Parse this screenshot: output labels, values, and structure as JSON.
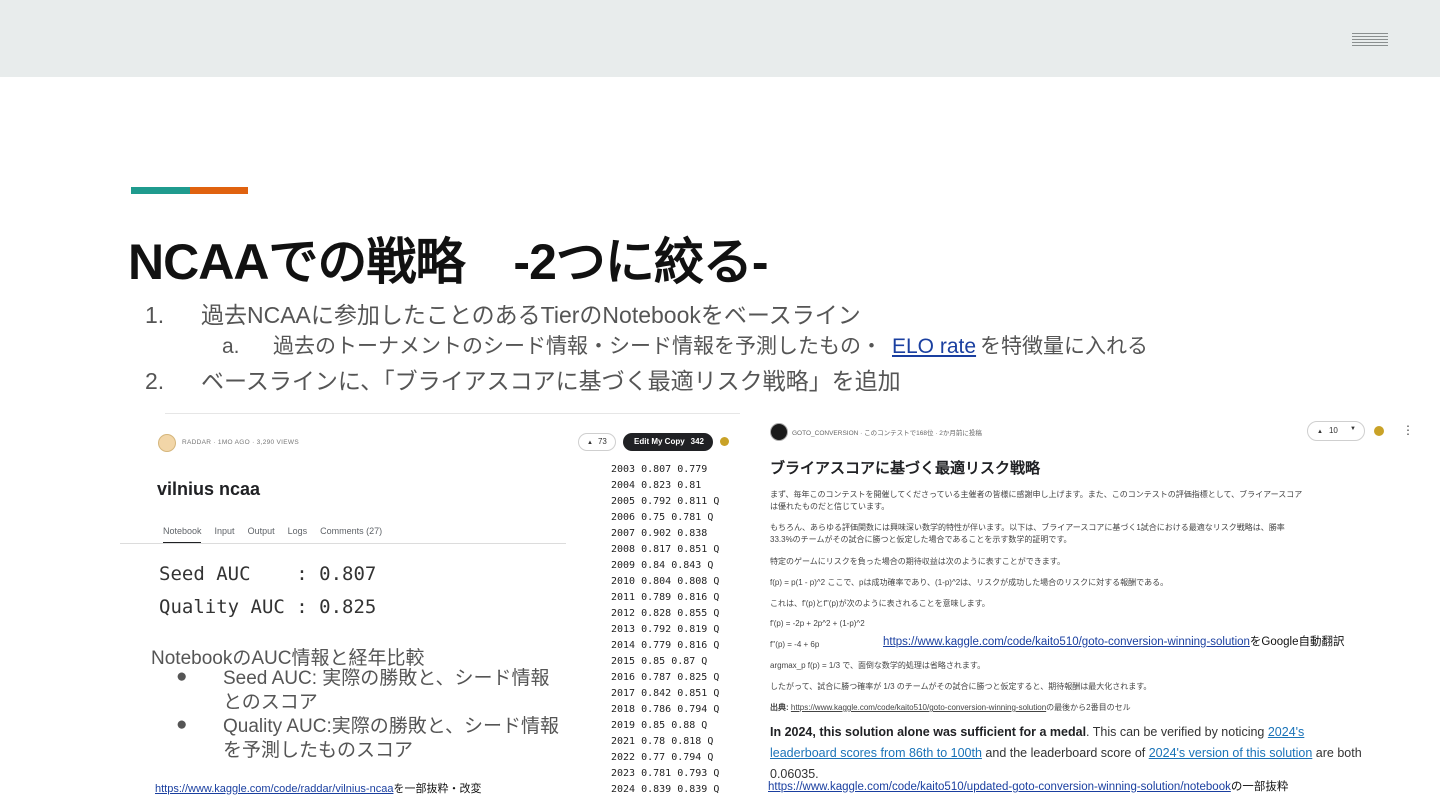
{
  "slide": {
    "title": "NCAAでの戦略　-2つに絞る-",
    "outline": [
      {
        "num": "1.",
        "text": "過去NCAAに参加したことのあるTierのNotebookをベースライン"
      },
      {
        "num": "2.",
        "text": "ベースラインに、「ブライアスコアに基づく最適リスク戦略」を追加"
      }
    ],
    "sub": {
      "num": "a.",
      "before": "過去のトーナメントのシード情報・シード情報を予測したもの・",
      "link": "ELO rate",
      "after": "を特徴量に入れる"
    }
  },
  "left_shot": {
    "author": "RADDAR · 1MO AGO · 3,290 VIEWS",
    "votes": "73",
    "edit_label": "Edit My Copy",
    "edit_count": "342",
    "notebook_title": "vilnius ncaa",
    "tabs": [
      "Notebook",
      "Input",
      "Output",
      "Logs",
      "Comments (27)"
    ],
    "seed_auc": "Seed AUC    : 0.807",
    "quality_auc": "Quality AUC : 0.825",
    "years": [
      "2003 0.807 0.779",
      "2004 0.823 0.81",
      "2005 0.792 0.811 Q",
      "2006 0.75 0.781 Q",
      "2007 0.902 0.838",
      "2008 0.817 0.851 Q",
      "2009 0.84 0.843 Q",
      "2010 0.804 0.808 Q",
      "2011 0.789 0.816 Q",
      "2012 0.828 0.855 Q",
      "2013 0.792 0.819 Q",
      "2014 0.779 0.816 Q",
      "2015 0.85 0.87 Q",
      "2016 0.787 0.825 Q",
      "2017 0.842 0.851 Q",
      "2018 0.786 0.794 Q",
      "2019 0.85 0.88 Q",
      "2021 0.78 0.818 Q",
      "2022 0.77 0.794 Q",
      "2023 0.781 0.793 Q",
      "2024 0.839 0.839 Q"
    ]
  },
  "left_notes": {
    "heading": "NotebookのAUC情報と経年比較",
    "bullets": [
      "Seed AUC: 実際の勝敗と、シード情報とのスコア",
      "Quality AUC:実際の勝敗と、シード情報を予測したものスコア"
    ],
    "bullet_char": "●",
    "source_link": "https://www.kaggle.com/code/raddar/vilnius-ncaa",
    "source_suffix": "を一部抜粋・改変"
  },
  "right_shot": {
    "author": "GOTO_CONVERSION · このコンテストで168位 · 2か月前に投稿",
    "votes": "10",
    "title": "ブライアスコアに基づく最適リスク戦略",
    "para1": "まず、毎年このコンテストを開催してくださっている主催者の皆様に感謝申し上げます。また、このコンテストの評価指標として、ブライアースコアは優れたものだと信じています。",
    "para2": "もちろん、あらゆる評価関数には興味深い数学的特性が伴います。以下は、ブライアースコアに基づく1試合における最適なリスク戦略は、勝率33.3%のチームがその試合に勝つと仮定した場合であることを示す数学的証明です。",
    "para3": "特定のゲームにリスクを負った場合の期待収益は次のように表すことができます。",
    "eq1": "f(p) = p(1 - p)^2 ここで、pは成功確率であり、(1-p)^2は、リスクが成功した場合のリスクに対する報酬である。",
    "para4": "これは、f'(p)とf''(p)が次のように表されることを意味します。",
    "eq2": "f'(p) = -2p + 2p^2 + (1-p)^2",
    "eq3": "f''(p) = -4 + 6p",
    "eq4": "argmax_p f(p) = 1/3 で、面倒な数学的処理は省略されます。",
    "para5": "したがって、試合に勝つ確率が 1/3 のチームがその試合に勝つと仮定すると、期待報酬は最大化されます。",
    "src_label": "出典:",
    "src_link": "https://www.kaggle.com/code/kaito510/goto-conversion-winning-solution",
    "src_suffix": "の最後から2番目のセル",
    "eng_bold": "In 2024, this solution alone was sufficient for a medal",
    "eng_1": ". This can be verified by noticing ",
    "eng_link1": "2024's leaderboard scores from 86th to 100th",
    "eng_2": " and the leaderboard score of ",
    "eng_link2": "2024's version of this solution",
    "eng_3": " are both 0.06035.",
    "overlay_link": "https://www.kaggle.com/code/kaito510/goto-conversion-winning-solution",
    "overlay_suffix": "をGoogle自動翻訳",
    "bottom_link": "https://www.kaggle.com/code/kaito510/updated-goto-conversion-winning-solution/notebook",
    "bottom_suffix": "の一部抜粋"
  }
}
